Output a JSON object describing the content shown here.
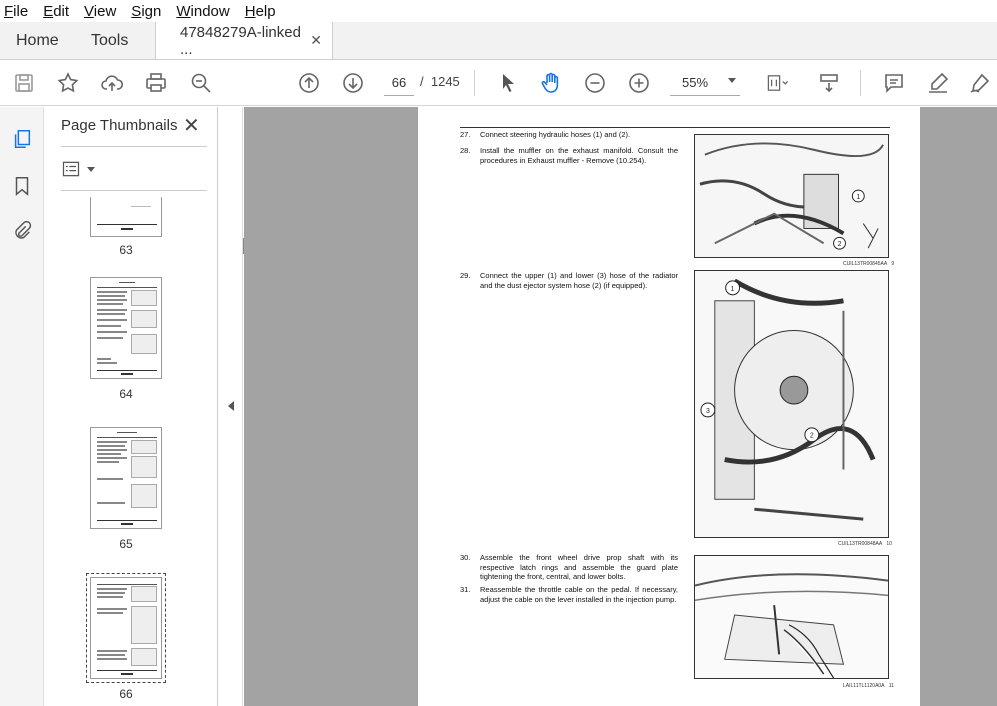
{
  "menu": [
    "File",
    "Edit",
    "View",
    "Sign",
    "Window",
    "Help"
  ],
  "tabs": {
    "home": "Home",
    "tools": "Tools",
    "document": "47848279A-linked ...",
    "close": "✕"
  },
  "toolbar": {
    "current_page": "66",
    "page_sep": "/",
    "total_pages": "1245",
    "zoom": "55%"
  },
  "panel": {
    "title": "Page Thumbnails",
    "close": "✕",
    "thumbnails": [
      {
        "label": "63",
        "selected": false
      },
      {
        "label": "64",
        "selected": false
      },
      {
        "label": "65",
        "selected": false
      },
      {
        "label": "66",
        "selected": true
      }
    ]
  },
  "page": {
    "steps": [
      {
        "num": "27.",
        "text": "Connect steering hydraulic hoses (1) and (2)."
      },
      {
        "num": "28.",
        "text": "Install the muffler on the exhaust manifold. Consult the procedures in Exhaust muffler - Remove (10.254)."
      },
      {
        "num": "29.",
        "text": "Connect the upper (1) and lower (3) hose of the radiator and the dust ejector system hose (2) (if equipped)."
      },
      {
        "num": "30.",
        "text": "Assemble the front wheel drive prop shaft with its respective latch rings and assemble the guard plate tightening the front, central, and lower bolts."
      },
      {
        "num": "31.",
        "text": "Reassemble the throttle cable on the pedal. If necessary, adjust the cable on the lever installed in the injection pump."
      }
    ],
    "figures": [
      {
        "caption": "CUIL13TR00845AA",
        "index": "9",
        "callouts": [
          "1",
          "2"
        ]
      },
      {
        "caption": "CUIL13TR00848AA",
        "index": "10",
        "callouts": [
          "1",
          "2",
          "3"
        ]
      },
      {
        "caption": "LAIL11TL1120A0A",
        "index": "11",
        "callouts": []
      }
    ]
  }
}
